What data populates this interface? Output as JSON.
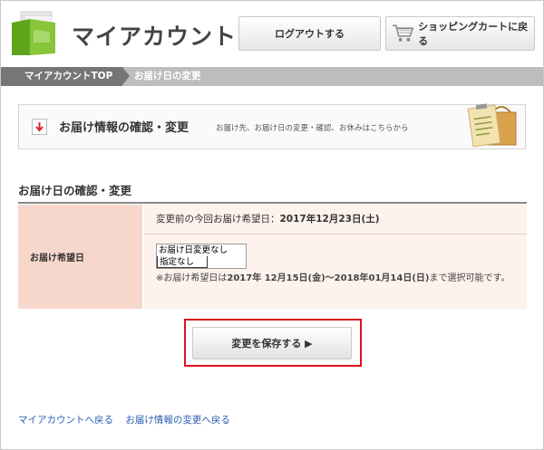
{
  "header": {
    "logo_text": "マイアカウント",
    "logout_label": "ログアウトする",
    "cart_label": "ショッピングカートに戻る"
  },
  "breadcrumb": {
    "items": [
      "マイアカウントTOP",
      "お届け日の変更"
    ]
  },
  "banner": {
    "title": "お届け情報の確認・変更",
    "description": "お届け先、お届け日の変更・確認、お休みはこちらから"
  },
  "section": {
    "title": "お届け日の確認・変更",
    "row_label": "お届け希望日",
    "previous_prefix": "変更前の今回お届け希望日：",
    "previous_value": "2017年12月23日(土)",
    "options": [
      "お届け日変更なし",
      "指定なし"
    ],
    "selected_option": "指定なし",
    "note_prefix": "※お届け希望日は",
    "note_range": "2017年 12月15日(金)〜2018年01月14日(日)",
    "note_suffix": "まで選択可能です。"
  },
  "save_button": {
    "label": "変更を保存する ▶"
  },
  "footer": {
    "links": [
      "マイアカウントへ戻る",
      "お届け情報の変更へ戻る"
    ]
  },
  "colors": {
    "accent_red": "#e0141b",
    "label_bg": "#f7d7cc",
    "value_bg": "#fef2ec",
    "breadcrumb_dark": "#767676",
    "breadcrumb_light": "#bdbdbd",
    "logo_green": "#7fbf2a",
    "link": "#2a5db0"
  }
}
